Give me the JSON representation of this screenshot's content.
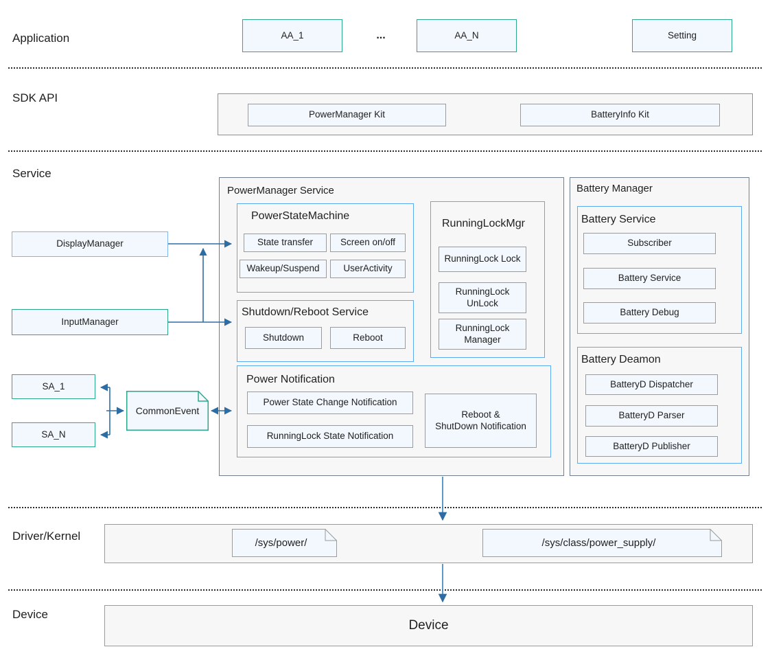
{
  "layers": [
    {
      "id": "application",
      "label": "Application"
    },
    {
      "id": "sdk-api",
      "label": "SDK API"
    },
    {
      "id": "service",
      "label": "Service"
    },
    {
      "id": "driver-kernel",
      "label": "Driver/Kernel"
    },
    {
      "id": "device",
      "label": "Device"
    }
  ],
  "application": {
    "apps": [
      {
        "label": "AA_1"
      },
      {
        "label": "AA_N"
      },
      {
        "label": "Setting"
      }
    ],
    "ellipsis": "..."
  },
  "sdk_api": {
    "kits": [
      {
        "label": "PowerManager Kit"
      },
      {
        "label": "BatteryInfo Kit"
      }
    ]
  },
  "service": {
    "external": [
      {
        "label": "DisplayManager"
      },
      {
        "label": "InputManager"
      },
      {
        "label": "SA_1"
      },
      {
        "label": "SA_N"
      }
    ],
    "common_event": {
      "label": "CommonEvent"
    },
    "power_manager_service": {
      "title": "PowerManager Service",
      "groups": [
        {
          "title": "PowerStateMachine",
          "items": [
            {
              "label": "State transfer"
            },
            {
              "label": "Screen on/off"
            },
            {
              "label": "Wakeup/Suspend"
            },
            {
              "label": "UserActivity"
            }
          ]
        },
        {
          "title": "RunningLockMgr",
          "items": [
            {
              "label": "RunningLock Lock"
            },
            {
              "label": "RunningLock\nUnLock"
            },
            {
              "label": "RunningLock\nManager"
            }
          ]
        },
        {
          "title": "Shutdown/Reboot Service",
          "items": [
            {
              "label": "Shutdown"
            },
            {
              "label": "Reboot"
            }
          ]
        },
        {
          "title": "Power Notification",
          "items": [
            {
              "label": "Power State Change Notification"
            },
            {
              "label": "RunningLock State Notification"
            },
            {
              "label": "Reboot &\nShutDown Notification"
            }
          ]
        }
      ]
    },
    "battery_manager": {
      "title": "Battery Manager",
      "groups": [
        {
          "title": "Battery Service",
          "items": [
            {
              "label": "Subscriber"
            },
            {
              "label": "Battery Service"
            },
            {
              "label": "Battery Debug"
            }
          ]
        },
        {
          "title": "Battery Deamon",
          "items": [
            {
              "label": "BatteryD Dispatcher"
            },
            {
              "label": "BatteryD Parser"
            },
            {
              "label": "BatteryD Publisher"
            }
          ]
        }
      ]
    }
  },
  "driver_kernel": {
    "nodes": [
      {
        "label": "/sys/power/"
      },
      {
        "label": "/sys/class/power_supply/"
      }
    ]
  },
  "device": {
    "label": "Device"
  },
  "colors": {
    "teal_border": "#2aa88b",
    "blue_border": "#7cb5f0",
    "gray_border": "#9a9a9a",
    "panel_border": "#6f7f8f",
    "group_border": "#5ba9ef",
    "box_fill": "#f2f8fe",
    "panel_fill": "#f7f7f7",
    "arrow": "#2e6da4",
    "divider": "#2b2b2b"
  }
}
